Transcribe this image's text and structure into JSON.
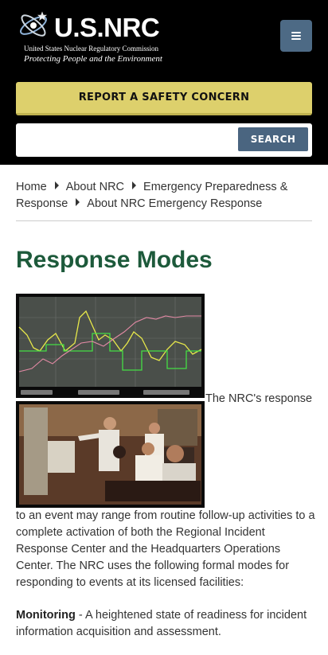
{
  "header": {
    "logo_word": "U.S.NRC",
    "logo_subtitle": "United States Nuclear Regulatory Commission",
    "logo_tagline": "Protecting People and the Environment",
    "menu_icon": "hamburger-icon",
    "safety_label": "REPORT A SAFETY CONCERN",
    "search_placeholder": "",
    "search_label": "SEARCH",
    "colors": {
      "background": "#000000",
      "safety": "#ddd06c",
      "accent": "#4a6580"
    }
  },
  "breadcrumb": {
    "items": [
      "Home",
      "About NRC",
      "Emergency Preparedness &",
      "Response",
      "About NRC Emergency Response"
    ]
  },
  "main": {
    "title": "Response Modes",
    "title_color": "#1d5a3b",
    "inline_text": "The NRC's response",
    "paragraph": "to an event may range from routine follow-up activities to a complete activation of both the Regional Incident Response Center and the Headquarters Operations Center. The NRC uses the following formal modes for responding to events at its licensed facilities:",
    "mode_term": "Monitoring",
    "mode_desc": " - A heightened state of readiness for incident information acquisition and assessment."
  }
}
